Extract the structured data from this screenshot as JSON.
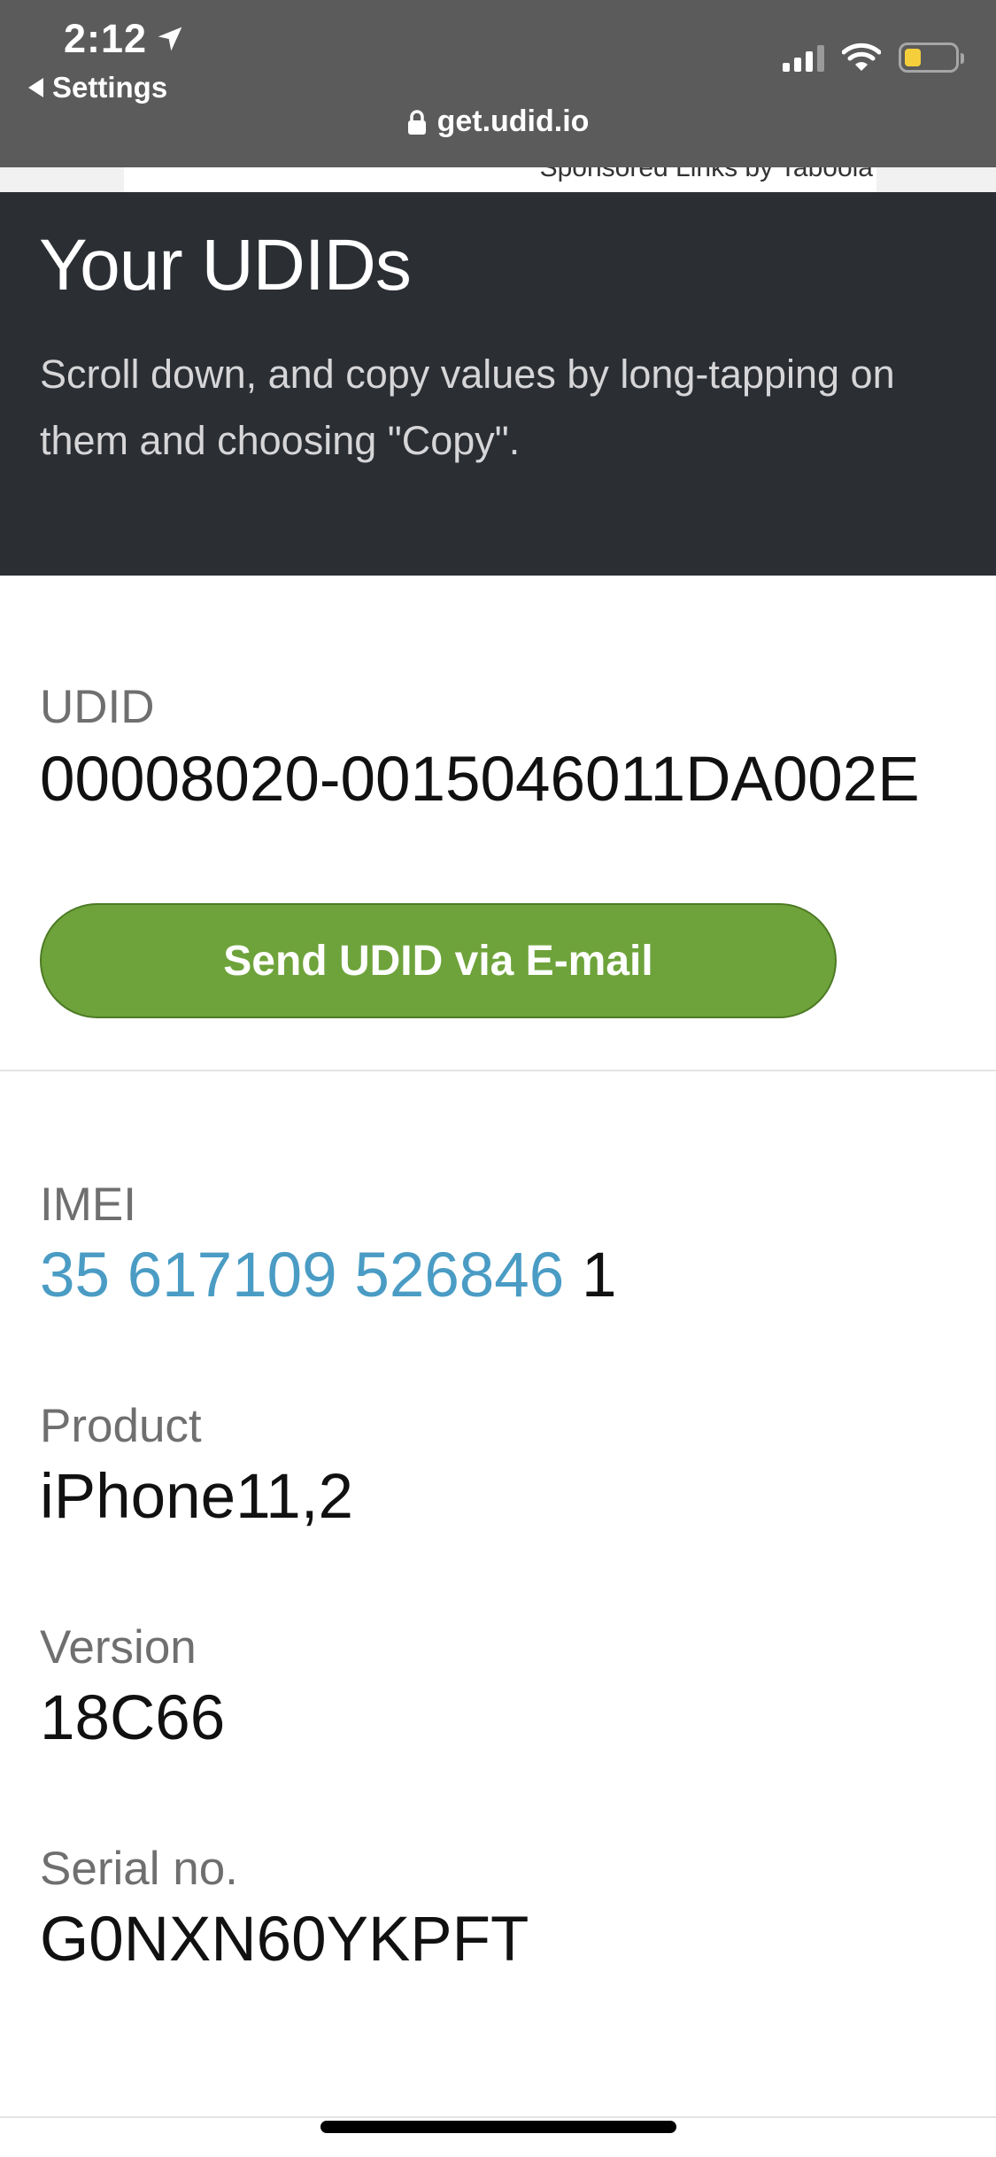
{
  "status_bar": {
    "time": "2:12",
    "back_label": "Settings",
    "url": "get.udid.io",
    "icons": [
      "location-arrow-icon",
      "cellular-signal-icon",
      "wifi-icon",
      "battery-icon",
      "lock-icon"
    ],
    "battery_color": "#f5cf3b"
  },
  "ad": {
    "text": "Sponsored Links by Taboola"
  },
  "hero": {
    "title": "Your UDIDs",
    "subtitle": "Scroll down, and copy values by long-tapping on them and choosing \"Copy\"."
  },
  "udid": {
    "label": "UDID",
    "value": "00008020-0015046011DA002E"
  },
  "email_button": {
    "label": "Send UDID via E-mail",
    "color": "#6ea33b"
  },
  "imei": {
    "label": "IMEI",
    "value_link": "35 617109 526846",
    "value_suffix": " 1",
    "link_color": "#4a9cc4"
  },
  "product": {
    "label": "Product",
    "value": "iPhone11,2"
  },
  "version": {
    "label": "Version",
    "value": "18C66"
  },
  "serial": {
    "label": "Serial no.",
    "value": "G0NXN60YKPFT"
  }
}
